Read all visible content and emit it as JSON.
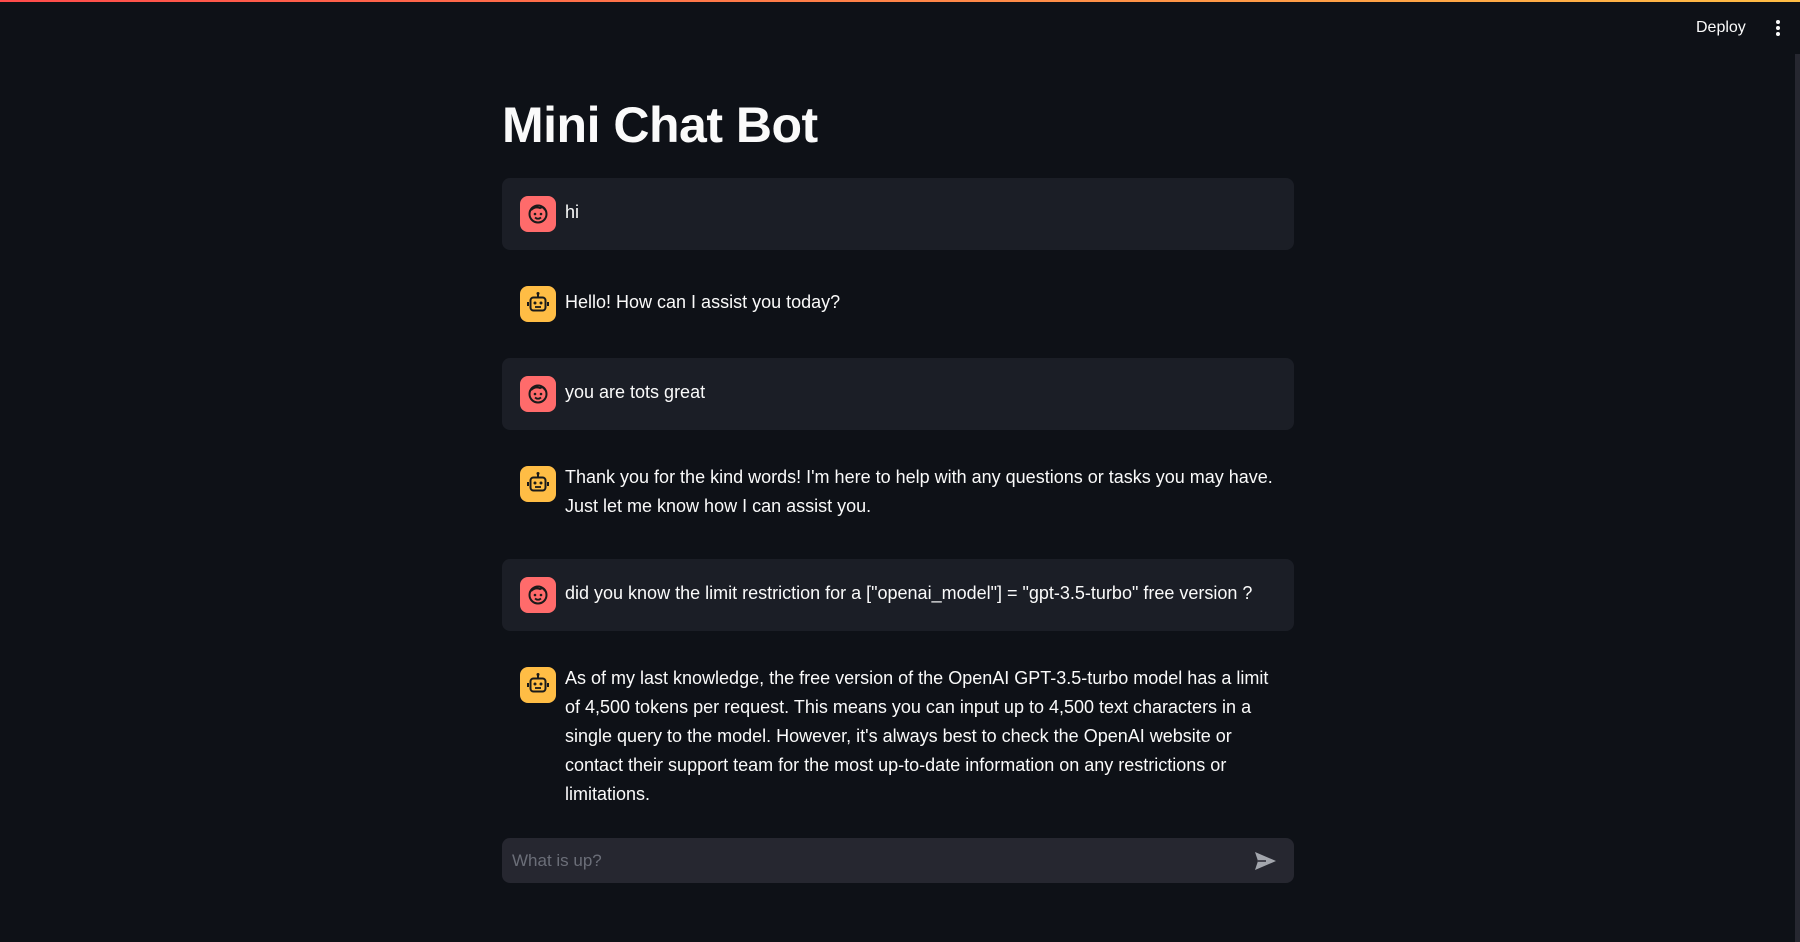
{
  "header": {
    "deploy_label": "Deploy",
    "menu_icon": "more-vertical-icon"
  },
  "page": {
    "title": "Mini Chat Bot"
  },
  "messages": [
    {
      "role": "user",
      "avatar_icon": "user-face-icon",
      "text": "hi"
    },
    {
      "role": "assistant",
      "avatar_icon": "robot-icon",
      "text": "Hello! How can I assist you today?"
    },
    {
      "role": "user",
      "avatar_icon": "user-face-icon",
      "text": "you are tots great"
    },
    {
      "role": "assistant",
      "avatar_icon": "robot-icon",
      "text": "Thank you for the kind words! I'm here to help with any questions or tasks you may have. Just let me know how I can assist you."
    },
    {
      "role": "user",
      "avatar_icon": "user-face-icon",
      "text": "did you know the limit restriction for a [\"openai_model\"] = \"gpt-3.5-turbo\" free version ?"
    },
    {
      "role": "assistant",
      "avatar_icon": "robot-icon",
      "text": "As of my last knowledge, the free version of the OpenAI GPT-3.5-turbo model has a limit of 4,500 tokens per request. This means you can input up to 4,500 text characters in a single query to the model. However, it's always best to check the OpenAI website or contact their support team for the most up-to-date information on any restrictions or limitations."
    }
  ],
  "chat_input": {
    "placeholder": "What is up?",
    "value": "",
    "send_icon": "send-icon"
  },
  "colors": {
    "background": "#0e1117",
    "user_message_bg": "#1b1e26",
    "user_avatar": "#ff6b6b",
    "assistant_avatar": "#ffbd45",
    "input_bg": "#262730",
    "accent_gradient_start": "#ff4b4b",
    "accent_gradient_end": "#ffbd45"
  }
}
